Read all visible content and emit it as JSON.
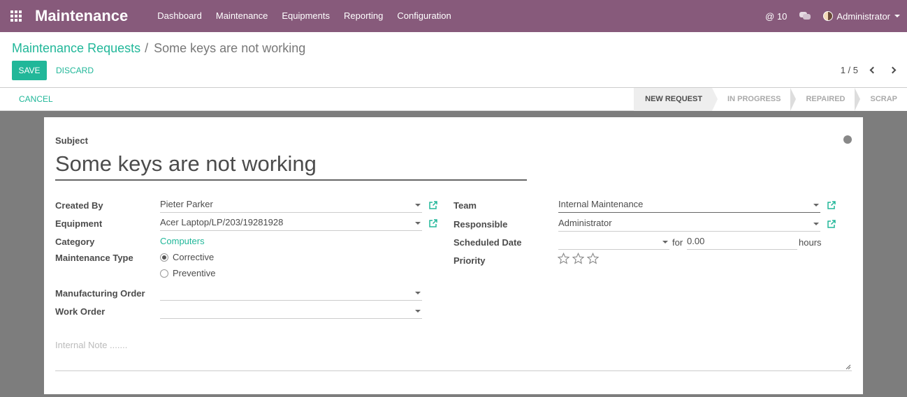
{
  "navbar": {
    "brand": "Maintenance",
    "menu": [
      "Dashboard",
      "Maintenance",
      "Equipments",
      "Reporting",
      "Configuration"
    ],
    "mentions_count": "@ 10",
    "user": "Administrator"
  },
  "control": {
    "breadcrumb_parent": "Maintenance Requests",
    "breadcrumb_sep": "/",
    "breadcrumb_current": "Some keys are not working",
    "save_label": "SAVE",
    "discard_label": "DISCARD",
    "pager": "1 / 5"
  },
  "statusbar": {
    "cancel_label": "CANCEL",
    "stages": [
      "NEW REQUEST",
      "IN PROGRESS",
      "REPAIRED",
      "SCRAP"
    ],
    "active_stage": "NEW REQUEST"
  },
  "form": {
    "subject_label": "Subject",
    "subject_value": "Some keys are not working",
    "created_by_label": "Created By",
    "created_by_value": "Pieter Parker",
    "equipment_label": "Equipment",
    "equipment_value": "Acer Laptop/LP/203/19281928",
    "category_label": "Category",
    "category_value": "Computers",
    "maintenance_type_label": "Maintenance Type",
    "maintenance_type_options": [
      "Corrective",
      "Preventive"
    ],
    "maintenance_type_selected": "Corrective",
    "manufacturing_order_label": "Manufacturing Order",
    "manufacturing_order_value": "",
    "work_order_label": "Work Order",
    "work_order_value": "",
    "team_label": "Team",
    "team_value": "Internal Maintenance",
    "responsible_label": "Responsible",
    "responsible_value": "Administrator",
    "scheduled_date_label": "Scheduled Date",
    "scheduled_date_value": "",
    "for_label": "for",
    "duration_value": "0.00",
    "hours_label": "hours",
    "priority_label": "Priority",
    "priority_stars_total": 3,
    "priority_value": 0,
    "internal_note_placeholder": "Internal Note ......."
  },
  "colors": {
    "navbar": "#875a7b",
    "accent": "#21b799",
    "background": "#7d7d7d"
  }
}
